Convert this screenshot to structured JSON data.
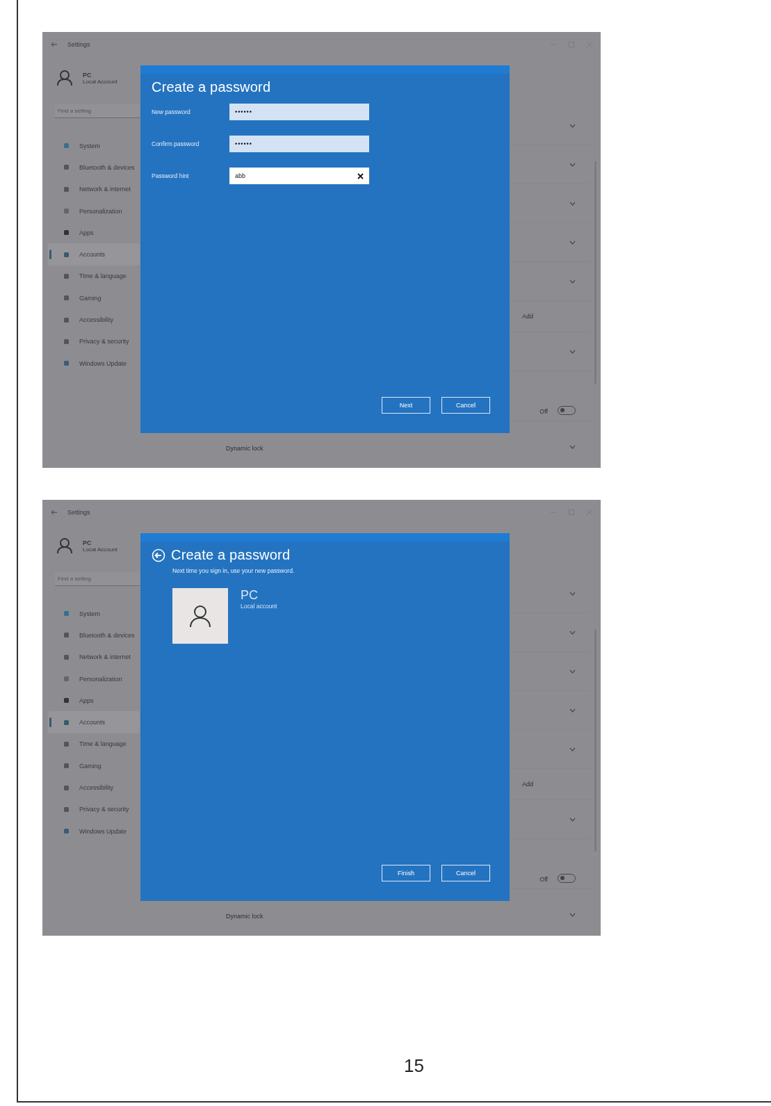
{
  "screenshots": [
    {
      "window": {
        "title": "Settings"
      },
      "account": {
        "name": "PC",
        "type": "Local Account"
      },
      "search": {
        "placeholder": "Find a setting"
      },
      "nav": [
        {
          "label": "System",
          "selected": false
        },
        {
          "label": "Bluetooth & devices",
          "selected": false
        },
        {
          "label": "Network & internet",
          "selected": false
        },
        {
          "label": "Personalization",
          "selected": false
        },
        {
          "label": "Apps",
          "selected": false
        },
        {
          "label": "Accounts",
          "selected": true
        },
        {
          "label": "Time & language",
          "selected": false
        },
        {
          "label": "Gaming",
          "selected": false
        },
        {
          "label": "Accessibility",
          "selected": false
        },
        {
          "label": "Privacy & security",
          "selected": false
        },
        {
          "label": "Windows Update",
          "selected": false
        }
      ],
      "rows": [
        {
          "kind": "expander"
        },
        {
          "kind": "expander"
        },
        {
          "kind": "expander"
        },
        {
          "kind": "expander"
        },
        {
          "kind": "expander"
        },
        {
          "kind": "button",
          "label": "Add"
        },
        {
          "kind": "expander"
        },
        {
          "kind": "toggle",
          "label": "Off",
          "on": false
        },
        {
          "kind": "expander",
          "title": "Dynamic lock"
        }
      ],
      "dialog": {
        "kind": "form",
        "title": "Create a password",
        "back": false,
        "fields": [
          {
            "kind": "password",
            "label": "New password",
            "value": "••••••"
          },
          {
            "kind": "password",
            "label": "Confirm password",
            "value": "••••••"
          },
          {
            "kind": "text",
            "label": "Password hint",
            "value": "abb",
            "clearable": true
          }
        ],
        "buttons": [
          "Next",
          "Cancel"
        ]
      }
    },
    {
      "window": {
        "title": "Settings"
      },
      "account": {
        "name": "PC",
        "type": "Local Account"
      },
      "search": {
        "placeholder": "Find a setting"
      },
      "nav": [
        {
          "label": "System",
          "selected": false
        },
        {
          "label": "Bluetooth & devices",
          "selected": false
        },
        {
          "label": "Network & internet",
          "selected": false
        },
        {
          "label": "Personalization",
          "selected": false
        },
        {
          "label": "Apps",
          "selected": false
        },
        {
          "label": "Accounts",
          "selected": true
        },
        {
          "label": "Time & language",
          "selected": false
        },
        {
          "label": "Gaming",
          "selected": false
        },
        {
          "label": "Accessibility",
          "selected": false
        },
        {
          "label": "Privacy & security",
          "selected": false
        },
        {
          "label": "Windows Update",
          "selected": false
        }
      ],
      "rows": [
        {
          "kind": "expander"
        },
        {
          "kind": "expander"
        },
        {
          "kind": "expander"
        },
        {
          "kind": "expander"
        },
        {
          "kind": "expander"
        },
        {
          "kind": "button",
          "label": "Add"
        },
        {
          "kind": "expander"
        },
        {
          "kind": "toggle",
          "label": "Off",
          "on": false
        },
        {
          "kind": "expander",
          "title": "Dynamic lock"
        }
      ],
      "dialog": {
        "kind": "summary",
        "title": "Create a password",
        "back": true,
        "message": "Next time you sign in, use your new password.",
        "account": {
          "name": "PC",
          "type": "Local account"
        },
        "buttons": [
          "Finish",
          "Cancel"
        ]
      }
    }
  ],
  "page_number": "15"
}
